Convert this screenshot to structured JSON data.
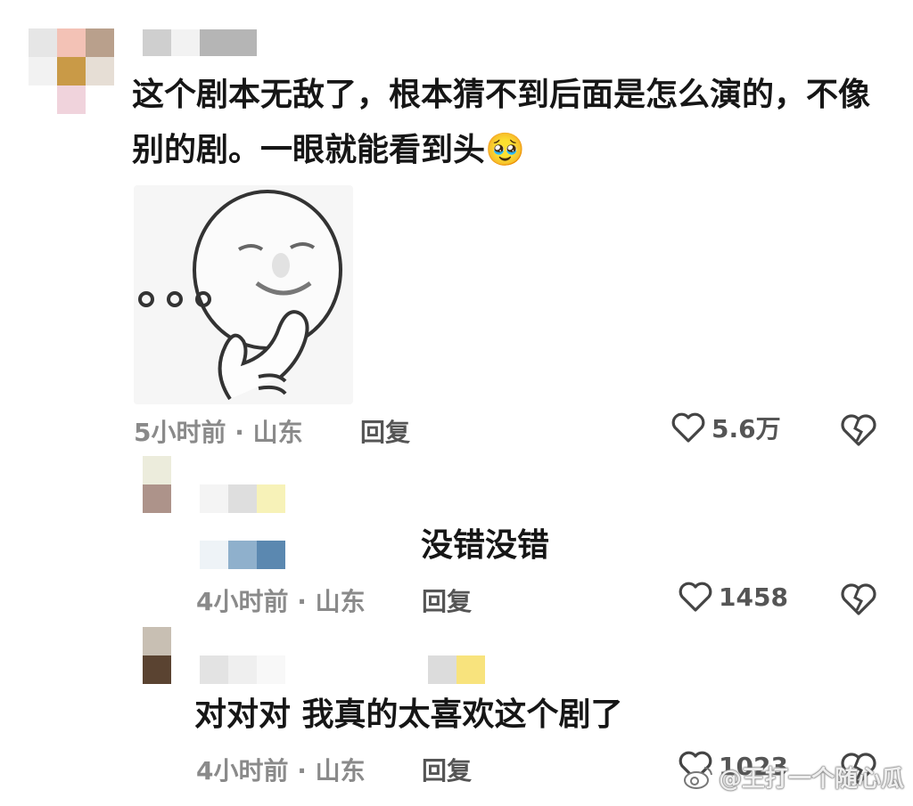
{
  "comments": [
    {
      "text": "这个剧本无敌了，根本猜不到后面是怎么演的，不像别的剧。一眼就能看到头",
      "emoji": "🥹",
      "time_location": "5小时前 · 山东",
      "reply_label": "回复",
      "likes": "5.6万"
    },
    {
      "text": "没错没错",
      "time_location": "4小时前 · 山东",
      "reply_label": "回复",
      "likes": "1458"
    },
    {
      "text": "对对对 我真的太喜欢这个剧了",
      "time_location": "4小时前 · 山东",
      "reply_label": "回复",
      "likes": "1023"
    }
  ],
  "watermark": "@王打一个随心瓜",
  "icons": {
    "like": "heart-outline-icon",
    "dislike": "broken-heart-icon",
    "weibo": "weibo-logo-icon"
  }
}
